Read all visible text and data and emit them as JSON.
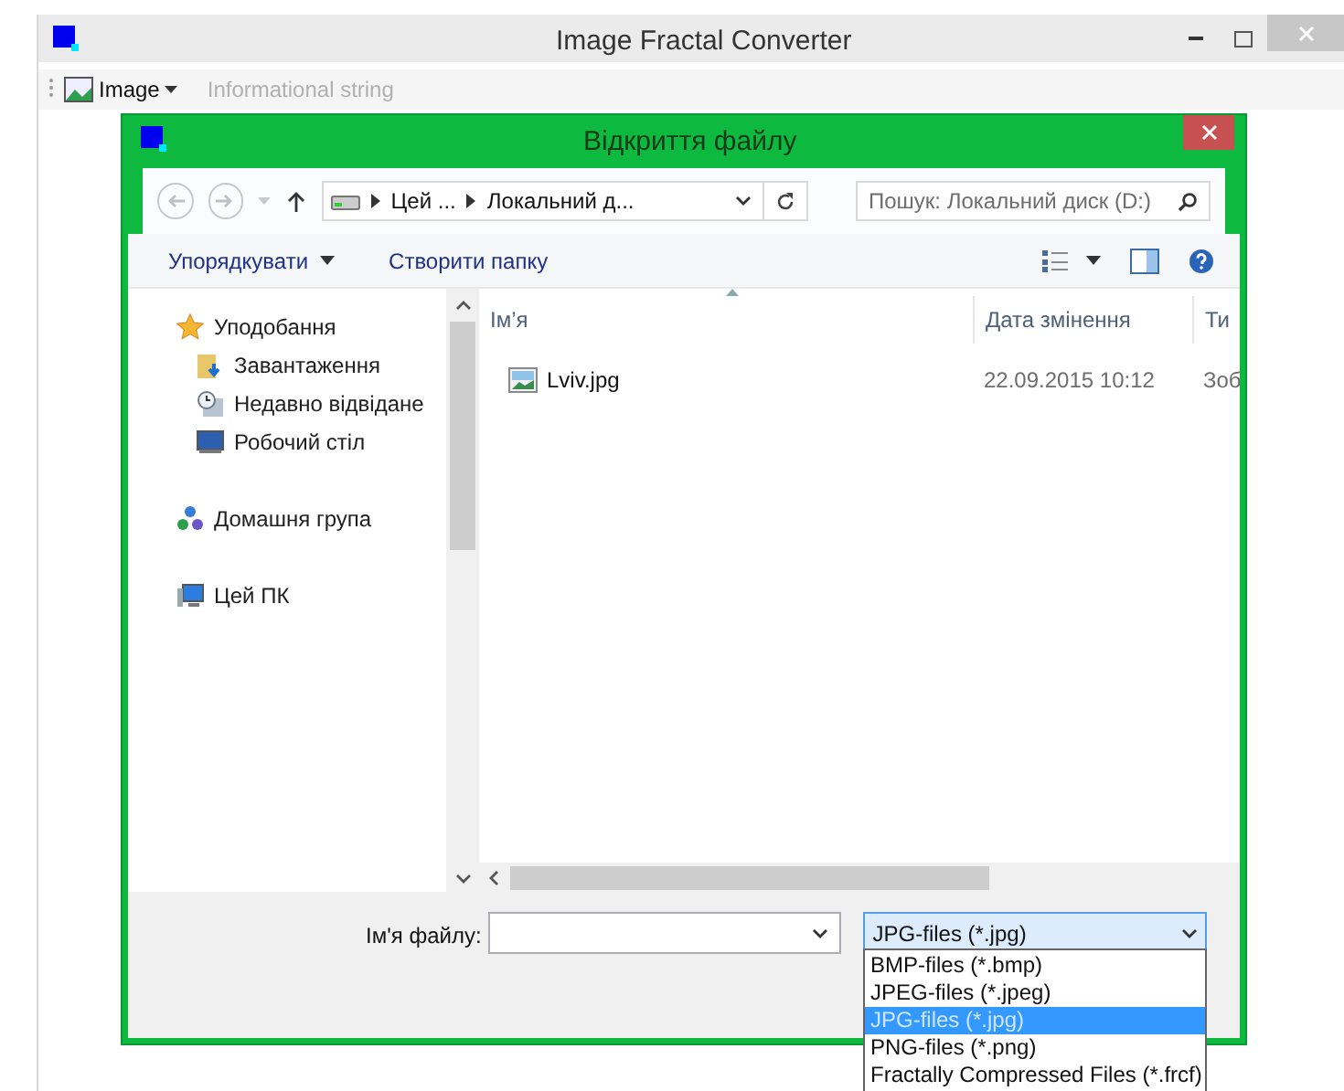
{
  "window": {
    "title": "Image Fractal Converter"
  },
  "toolbar": {
    "menu": "Image",
    "info": "Informational string"
  },
  "dialog": {
    "title": "Відкриття файлу",
    "address": {
      "crumbs": [
        "Цей ...",
        "Локальний д..."
      ]
    },
    "search": {
      "placeholder": "Пошук: Локальний диск (D:)"
    },
    "commands": [
      {
        "label": "Упорядкувати",
        "dropdown": true
      },
      {
        "label": "Створити папку",
        "dropdown": false
      }
    ],
    "nav": [
      {
        "label": "Уподобання",
        "kind": "favorites",
        "children": [
          {
            "label": "Завантаження",
            "kind": "downloads"
          },
          {
            "label": "Недавно відвідане",
            "kind": "recent"
          },
          {
            "label": "Робочий стіл",
            "kind": "desktop"
          }
        ]
      },
      {
        "label": "Домашня група",
        "kind": "homegroup"
      },
      {
        "label": "Цей ПК",
        "kind": "pc"
      }
    ],
    "columns": [
      "Ім’я",
      "Дата змінення",
      "Ти"
    ],
    "rows": [
      {
        "name": "Lviv.jpg",
        "date": "22.09.2015 10:12",
        "type": "Зоб"
      }
    ],
    "filename": {
      "label": "Ім'я файлу:"
    },
    "filetype": {
      "value": "JPG-files (*.jpg)",
      "options": [
        {
          "label": "BMP-files (*.bmp)",
          "selected": false
        },
        {
          "label": "JPEG-files (*.jpeg)",
          "selected": false
        },
        {
          "label": "JPG-files (*.jpg)",
          "selected": true
        },
        {
          "label": "PNG-files (*.png)",
          "selected": false
        },
        {
          "label": "Fractally Compressed Files (*.frcf)",
          "selected": false
        }
      ]
    }
  }
}
